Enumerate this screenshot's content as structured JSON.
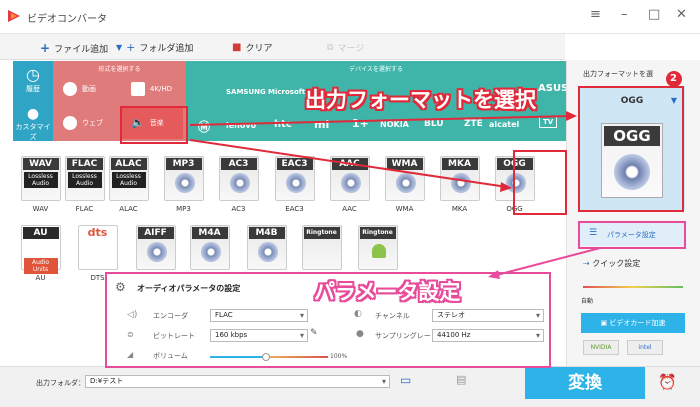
{
  "window": {
    "title": "ビデオコンバータ"
  },
  "toolbar": {
    "add_file": "ファイル追加",
    "add_folder": "フォルダ追加",
    "clear": "クリア",
    "merge": "マージ"
  },
  "sidebar": {
    "history": "履歴",
    "custom": "カスタマイズ"
  },
  "category": {
    "label": "形式を選択する",
    "items": [
      {
        "label": "動画"
      },
      {
        "label": "4K/HD"
      },
      {
        "label": "ウェブ"
      },
      {
        "label": "音楽"
      }
    ]
  },
  "devices": {
    "label": "デバイスを選択する",
    "brands": [
      "SAMSUNG",
      "Microsoft",
      "ASUS",
      "htc",
      "mi",
      "NOKIA",
      "BLU",
      "ZTE",
      "alcatel",
      "TV",
      "lenovo"
    ]
  },
  "formats": [
    {
      "name": "WAV",
      "tag": "WAV",
      "sub": "Lossless Audio"
    },
    {
      "name": "FLAC",
      "tag": "FLAC",
      "sub": "Lossless Audio"
    },
    {
      "name": "ALAC",
      "tag": "ALAC",
      "sub": "Lossless Audio"
    },
    {
      "name": "MP3",
      "tag": "MP3",
      "sub": ""
    },
    {
      "name": "AC3",
      "tag": "AC3",
      "sub": ""
    },
    {
      "name": "EAC3",
      "tag": "EAC3",
      "sub": ""
    },
    {
      "name": "AAC",
      "tag": "AAC",
      "sub": ""
    },
    {
      "name": "WMA",
      "tag": "WMA",
      "sub": ""
    },
    {
      "name": "MKA",
      "tag": "MKA",
      "sub": ""
    },
    {
      "name": "OGG",
      "tag": "OGG",
      "sub": ""
    },
    {
      "name": "AU",
      "tag": "AU",
      "sub": "Audio Units"
    },
    {
      "name": "DTS",
      "tag": "dts",
      "sub": ""
    },
    {
      "name": "",
      "tag": "AIFF",
      "sub": ""
    },
    {
      "name": "",
      "tag": "M4A",
      "sub": ""
    },
    {
      "name": "",
      "tag": "M4B",
      "sub": ""
    },
    {
      "name": "",
      "tag": "Ringtone",
      "sub": ""
    },
    {
      "name": "",
      "tag": "Ringtone",
      "sub": ""
    }
  ],
  "right_panel": {
    "output_format_label": "出力フォーマットを選",
    "selected_format": "OGG",
    "param_button": "パラメータ設定",
    "quick_label": "クイック設定",
    "auto_label": "自動",
    "gpu_button": "ビデオカード加速",
    "nvidia": "NVIDIA",
    "intel": "intel"
  },
  "param_panel": {
    "title": "オーディオパラメータの設定",
    "encoder_label": "エンコーダ",
    "encoder_value": "FLAC",
    "bitrate_label": "ビットレート",
    "bitrate_value": "160 kbps",
    "volume_label": "ボリューム",
    "volume_value": "100%",
    "channel_label": "チャンネル",
    "channel_value": "ステレオ",
    "samplerate_label": "サンプリングレート",
    "samplerate_value": "44100 Hz"
  },
  "bottom": {
    "output_label": "出力フォルダ：",
    "output_path": "D:¥テスト",
    "convert": "変換"
  },
  "annotations": {
    "step_number": "2",
    "title1": "出力フォーマットを選択",
    "title2": "パラメータ設定"
  },
  "colors": {
    "teal": "#3fb5aa",
    "category_red": "#e07b7b",
    "accent_blue": "#2db3e8",
    "highlight_red": "#e02a3a",
    "highlight_pink": "#e84b9a"
  }
}
